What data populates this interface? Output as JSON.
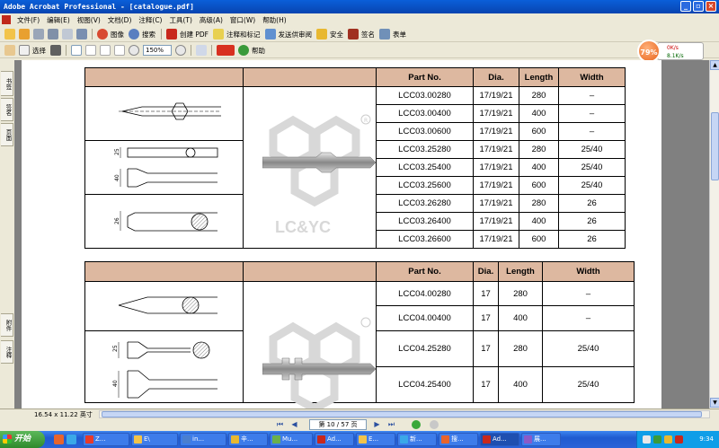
{
  "window": {
    "title": "Adobe Acrobat Professional - [catalogue.pdf]",
    "controls": [
      "_",
      "▫",
      "×"
    ]
  },
  "menu": [
    "文件(F)",
    "编辑(E)",
    "视图(V)",
    "文档(D)",
    "注释(C)",
    "工具(T)",
    "高级(A)",
    "窗口(W)",
    "帮助(H)"
  ],
  "toolbar1": {
    "image_label": "图像",
    "search_label": "搜索",
    "create_pdf": "创建 PDF",
    "comment": "注释和标记",
    "send_review": "发送供审阅",
    "security": "安全",
    "sign": "签名",
    "forms": "表单"
  },
  "toolbar2": {
    "select_label": "选择",
    "zoom_value": "150%",
    "help_label": "帮助"
  },
  "speed_widget": {
    "percent": "79%",
    "up": "0K/s",
    "down": "8.1K/s"
  },
  "left_tabs": [
    "书签",
    "签名",
    "页面",
    "附件",
    "注释"
  ],
  "status": {
    "page_size": "16.54 x 11.22 英寸",
    "page_box": "第 10 / 57 页"
  },
  "watermark": "LC&YC",
  "table1": {
    "headers": [
      "Part No.",
      "Dia.",
      "Length",
      "Width"
    ],
    "rows": [
      [
        "LCC03.00280",
        "17/19/21",
        "280",
        "–"
      ],
      [
        "LCC03.00400",
        "17/19/21",
        "400",
        "–"
      ],
      [
        "LCC03.00600",
        "17/19/21",
        "600",
        "–"
      ],
      [
        "LCC03.25280",
        "17/19/21",
        "280",
        "25/40"
      ],
      [
        "LCC03.25400",
        "17/19/21",
        "400",
        "25/40"
      ],
      [
        "LCC03.25600",
        "17/19/21",
        "600",
        "25/40"
      ],
      [
        "LCC03.26280",
        "17/19/21",
        "280",
        "26"
      ],
      [
        "LCC03.26400",
        "17/19/21",
        "400",
        "26"
      ],
      [
        "LCC03.26600",
        "17/19/21",
        "600",
        "26"
      ]
    ],
    "dims": [
      "25",
      "40",
      "26"
    ]
  },
  "table2": {
    "headers": [
      "Part No.",
      "Dia.",
      "Length",
      "Width"
    ],
    "rows": [
      [
        "LCC04.00280",
        "17",
        "280",
        "–"
      ],
      [
        "LCC04.00400",
        "17",
        "400",
        "–"
      ],
      [
        "LCC04.25280",
        "17",
        "280",
        "25/40"
      ],
      [
        "LCC04.25400",
        "17",
        "400",
        "25/40"
      ]
    ],
    "dims": [
      "25",
      "40"
    ]
  },
  "taskbar": {
    "start": "开始",
    "tasks": [
      "Z...",
      "E\\",
      "in...",
      "辛...",
      "Mu...",
      "Ad...",
      "E...",
      "新...",
      "搜...",
      "Ad...",
      "展..."
    ],
    "clock": "9:34"
  }
}
